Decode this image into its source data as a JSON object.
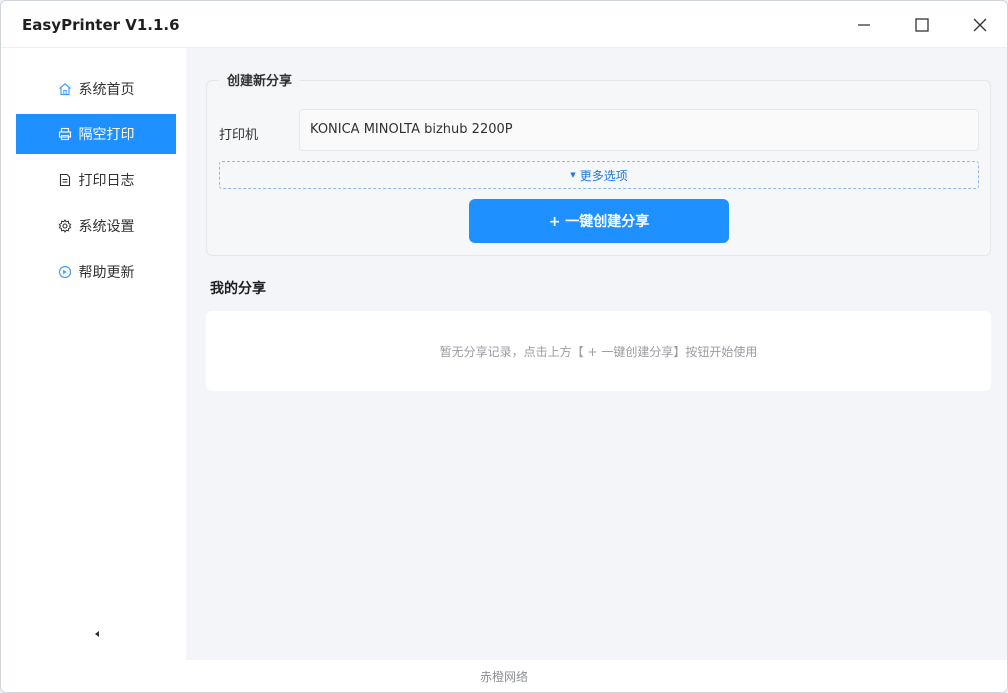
{
  "window": {
    "title": "EasyPrinter  V1.1.6",
    "controls": {
      "minimize": "minimize-icon",
      "maximize": "maximize-icon",
      "close": "close-icon"
    }
  },
  "sidebar": {
    "items": [
      {
        "label": "系统首页",
        "icon": "home-icon",
        "active": false
      },
      {
        "label": "隔空打印",
        "icon": "printer-icon",
        "active": true
      },
      {
        "label": "打印日志",
        "icon": "document-icon",
        "active": false
      },
      {
        "label": "系统设置",
        "icon": "gear-icon",
        "active": false
      },
      {
        "label": "帮助更新",
        "icon": "refresh-icon",
        "active": false
      }
    ],
    "collapse_icon": "collapse-left-icon"
  },
  "create_share": {
    "legend": "创建新分享",
    "printer_label": "打印机",
    "printer_value": "KONICA MINOLTA bizhub 2200P",
    "more_options": "更多选项",
    "create_button": "+ 一键创建分享"
  },
  "my_shares": {
    "title": "我的分享",
    "empty_text": "暂无分享记录，点击上方【 + 一键创建分享】按钮开始使用"
  },
  "footer": {
    "text": "赤橙网络"
  },
  "colors": {
    "accent": "#1e90ff",
    "link": "#1e78e6",
    "text": "#303133",
    "muted": "#9a9ca3"
  }
}
